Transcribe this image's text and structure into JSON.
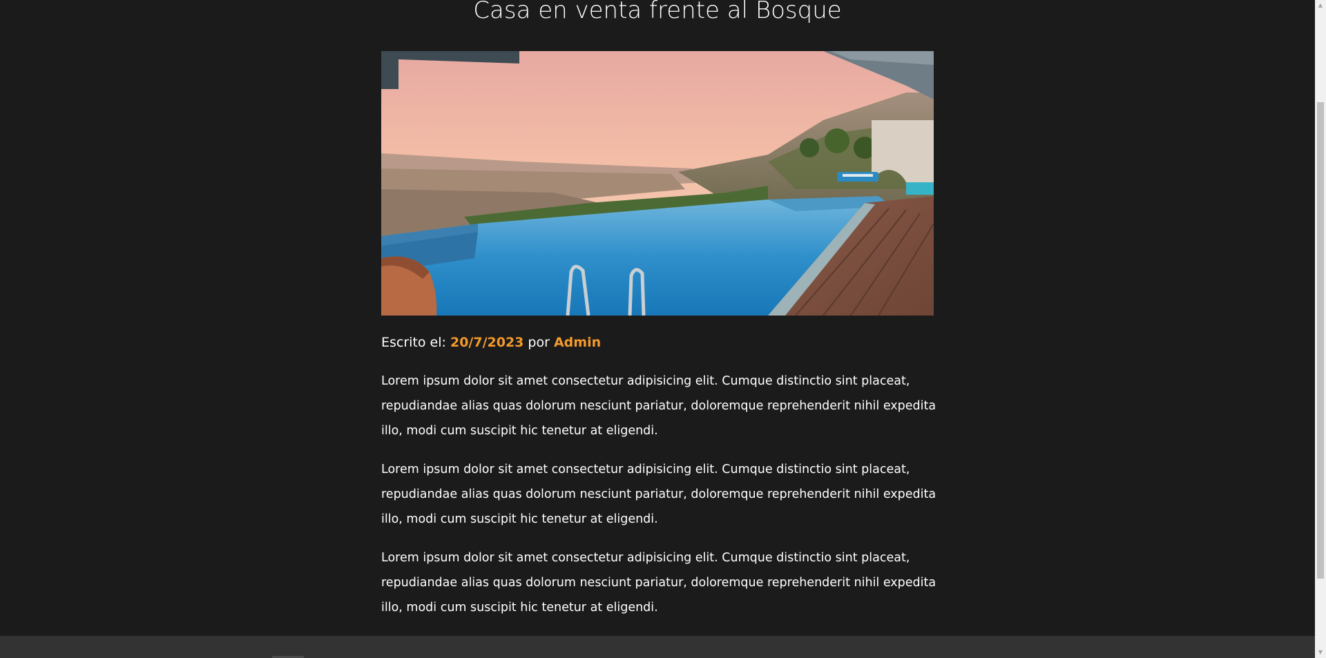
{
  "post": {
    "title": "Casa en venta frente al Bosque",
    "image_alt": "Piscina infinita con vista a las montañas al atardecer",
    "meta": {
      "prefix": "Escrito el: ",
      "date": "20/7/2023",
      "by": " por ",
      "author": "Admin"
    },
    "paragraphs": [
      "Lorem ipsum dolor sit amet consectetur adipisicing elit. Cumque distinctio sint placeat, repudiandae alias quas dolorum nesciunt pariatur, doloremque reprehenderit nihil expedita illo, modi cum suscipit hic tenetur at eligendi.",
      "Lorem ipsum dolor sit amet consectetur adipisicing elit. Cumque distinctio sint placeat, repudiandae alias quas dolorum nesciunt pariatur, doloremque reprehenderit nihil expedita illo, modi cum suscipit hic tenetur at eligendi.",
      "Lorem ipsum dolor sit amet consectetur adipisicing elit. Cumque distinctio sint placeat, repudiandae alias quas dolorum nesciunt pariatur, doloremque reprehenderit nihil expedita illo, modi cum suscipit hic tenetur at eligendi."
    ]
  },
  "colors": {
    "background": "#1b1b1b",
    "accent": "#f39a2c",
    "text": "#ffffff",
    "footer": "#333333"
  },
  "scrollbar": {
    "up_icon": "triangle-up-icon",
    "down_icon": "triangle-down-icon",
    "up_glyph": "▲",
    "down_glyph": "▼"
  }
}
